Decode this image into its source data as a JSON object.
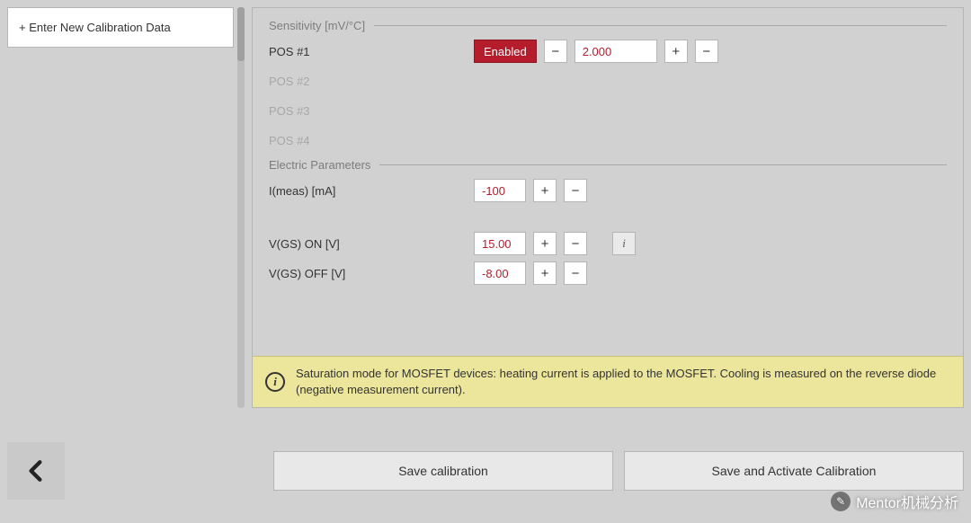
{
  "sidebar": {
    "new_calibration_label": "+ Enter New Calibration Data"
  },
  "sensitivity": {
    "header": "Sensitivity [mV/°C]",
    "rows": [
      {
        "label": "POS #1",
        "enabled_text": "Enabled",
        "value": "2.000"
      },
      {
        "label": "POS #2"
      },
      {
        "label": "POS #3"
      },
      {
        "label": "POS #4"
      }
    ]
  },
  "electric": {
    "header": "Electric Parameters",
    "imeas_label": "I(meas) [mA]",
    "imeas_value": "-100",
    "vgs_on_label": "V(GS) ON [V]",
    "vgs_on_value": "15.00",
    "vgs_off_label": "V(GS) OFF [V]",
    "vgs_off_value": "-8.00"
  },
  "banner": {
    "text": "Saturation mode for MOSFET devices: heating current is applied to the MOSFET. Cooling is measured on the reverse diode (negative measurement current)."
  },
  "buttons": {
    "save": "Save calibration",
    "save_activate": "Save and Activate Calibration"
  },
  "glyphs": {
    "plus": "+",
    "minus": "−",
    "info": "i"
  },
  "watermark": {
    "text": "Mentor机械分析"
  }
}
